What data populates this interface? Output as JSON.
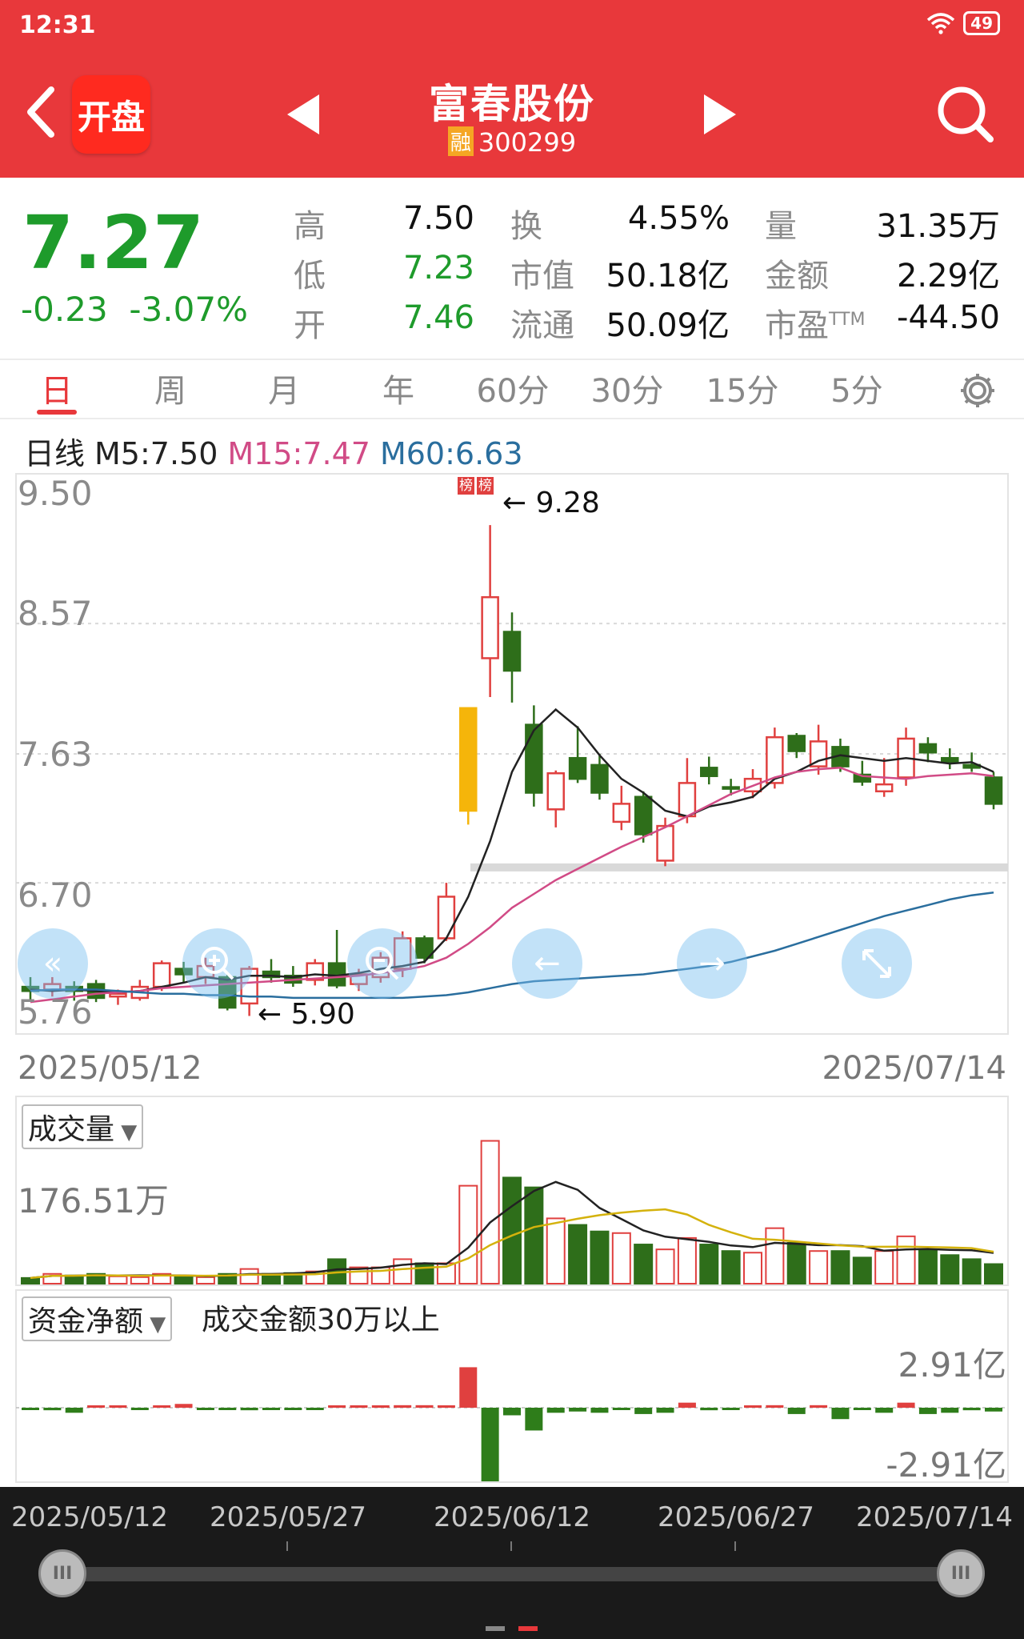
{
  "status": {
    "time": "12:31",
    "battery": "49"
  },
  "header": {
    "logo_text": "开盘",
    "name": "富春股份",
    "margin_badge": "融",
    "code": "300299"
  },
  "quote": {
    "price": "7.27",
    "change": "-0.23",
    "change_pct": "-3.07%",
    "stats": [
      {
        "label": "高",
        "value": "7.50"
      },
      {
        "label": "低",
        "value": "7.23"
      },
      {
        "label": "开",
        "value": "7.46"
      },
      {
        "label": "换",
        "value": "4.55%"
      },
      {
        "label": "市值",
        "value": "50.18亿"
      },
      {
        "label": "流通",
        "value": "50.09亿"
      },
      {
        "label": "量",
        "value": "31.35万"
      },
      {
        "label": "金额",
        "value": "2.29亿"
      },
      {
        "label": "市盈",
        "label_sup": "TTM",
        "value": "-44.50"
      }
    ]
  },
  "tabs": [
    "日",
    "周",
    "月",
    "年",
    "60分",
    "30分",
    "15分",
    "5分"
  ],
  "ma": {
    "title": "日线",
    "m5": "M5:7.50",
    "m15": "M15:7.47",
    "m60": "M60:6.63"
  },
  "price_axis": [
    "9.50",
    "8.57",
    "7.63",
    "6.70",
    "5.76"
  ],
  "annotations": {
    "high": "9.28",
    "low": "5.90",
    "bang": [
      "榜",
      "榜"
    ]
  },
  "range": {
    "start": "2025/05/12",
    "end": "2025/07/14"
  },
  "volume": {
    "label": "成交量",
    "max": "176.51万"
  },
  "fund": {
    "label": "资金净额",
    "desc": "成交金额30万以上",
    "max": "2.91亿",
    "min": "-2.91亿"
  },
  "scroller": {
    "dates": [
      "2025/05/12",
      "2025/05/27",
      "2025/06/12",
      "2025/06/27",
      "2025/07/14"
    ]
  },
  "colors": {
    "up": "#e0403f",
    "down": "#2e6e1a",
    "header": "#e8383b",
    "m5": "#222222",
    "m15": "#d14b86",
    "m60": "#2a6e9e"
  },
  "chart_data": {
    "type": "candlestick",
    "x_range": [
      "2025/05/12",
      "2025/07/14"
    ],
    "ylim": [
      5.76,
      9.5
    ],
    "candles": [
      {
        "o": 5.95,
        "c": 5.92,
        "h": 6.02,
        "l": 5.86
      },
      {
        "o": 5.93,
        "c": 5.97,
        "h": 6.02,
        "l": 5.88
      },
      {
        "o": 5.95,
        "c": 5.92,
        "h": 5.99,
        "l": 5.85
      },
      {
        "o": 5.97,
        "c": 5.87,
        "h": 6.0,
        "l": 5.84
      },
      {
        "o": 5.88,
        "c": 5.9,
        "h": 5.93,
        "l": 5.82
      },
      {
        "o": 5.87,
        "c": 5.95,
        "h": 6.0,
        "l": 5.85
      },
      {
        "o": 5.95,
        "c": 6.12,
        "h": 6.14,
        "l": 5.92
      },
      {
        "o": 6.08,
        "c": 6.04,
        "h": 6.13,
        "l": 5.98
      },
      {
        "o": 6.02,
        "c": 6.1,
        "h": 6.16,
        "l": 5.97
      },
      {
        "o": 6.02,
        "c": 5.8,
        "h": 6.04,
        "l": 5.78
      },
      {
        "o": 5.83,
        "c": 6.08,
        "h": 6.1,
        "l": 5.74
      },
      {
        "o": 6.06,
        "c": 6.02,
        "h": 6.15,
        "l": 5.98
      },
      {
        "o": 6.03,
        "c": 5.98,
        "h": 6.1,
        "l": 5.95
      },
      {
        "o": 6.0,
        "c": 6.12,
        "h": 6.15,
        "l": 5.96
      },
      {
        "o": 6.12,
        "c": 5.96,
        "h": 6.36,
        "l": 5.94
      },
      {
        "o": 5.97,
        "c": 6.04,
        "h": 6.08,
        "l": 5.92
      },
      {
        "o": 6.02,
        "c": 6.16,
        "h": 6.2,
        "l": 5.98
      },
      {
        "o": 6.08,
        "c": 6.3,
        "h": 6.35,
        "l": 6.02
      },
      {
        "o": 6.3,
        "c": 6.16,
        "h": 6.32,
        "l": 6.12
      },
      {
        "o": 6.3,
        "c": 6.6,
        "h": 6.7,
        "l": 6.28
      },
      {
        "o": 7.22,
        "c": 7.96,
        "h": 7.96,
        "l": 7.12,
        "limit_up": true
      },
      {
        "o": 8.32,
        "c": 8.76,
        "h": 9.28,
        "l": 8.04
      },
      {
        "o": 8.51,
        "c": 8.23,
        "h": 8.65,
        "l": 8.0
      },
      {
        "o": 7.84,
        "c": 7.35,
        "h": 7.98,
        "l": 7.25
      },
      {
        "o": 7.23,
        "c": 7.49,
        "h": 7.51,
        "l": 7.1
      },
      {
        "o": 7.6,
        "c": 7.45,
        "h": 7.83,
        "l": 7.42
      },
      {
        "o": 7.55,
        "c": 7.35,
        "h": 7.63,
        "l": 7.3
      },
      {
        "o": 7.14,
        "c": 7.27,
        "h": 7.4,
        "l": 7.08
      },
      {
        "o": 7.32,
        "c": 7.05,
        "h": 7.36,
        "l": 6.99
      },
      {
        "o": 6.86,
        "c": 7.11,
        "h": 7.17,
        "l": 6.82
      },
      {
        "o": 7.18,
        "c": 7.42,
        "h": 7.6,
        "l": 7.13
      },
      {
        "o": 7.53,
        "c": 7.47,
        "h": 7.61,
        "l": 7.41
      },
      {
        "o": 7.39,
        "c": 7.38,
        "h": 7.45,
        "l": 7.33
      },
      {
        "o": 7.36,
        "c": 7.45,
        "h": 7.52,
        "l": 7.31
      },
      {
        "o": 7.42,
        "c": 7.75,
        "h": 7.82,
        "l": 7.38
      },
      {
        "o": 7.76,
        "c": 7.65,
        "h": 7.78,
        "l": 7.6
      },
      {
        "o": 7.54,
        "c": 7.72,
        "h": 7.84,
        "l": 7.48
      },
      {
        "o": 7.68,
        "c": 7.54,
        "h": 7.74,
        "l": 7.5
      },
      {
        "o": 7.48,
        "c": 7.43,
        "h": 7.58,
        "l": 7.4
      },
      {
        "o": 7.36,
        "c": 7.41,
        "h": 7.6,
        "l": 7.32
      },
      {
        "o": 7.46,
        "c": 7.74,
        "h": 7.82,
        "l": 7.4
      },
      {
        "o": 7.7,
        "c": 7.64,
        "h": 7.75,
        "l": 7.57
      },
      {
        "o": 7.6,
        "c": 7.57,
        "h": 7.67,
        "l": 7.52
      },
      {
        "o": 7.55,
        "c": 7.53,
        "h": 7.64,
        "l": 7.5
      },
      {
        "o": 7.46,
        "c": 7.27,
        "h": 7.5,
        "l": 7.23
      }
    ],
    "ma_lines": [
      {
        "name": "M5",
        "values": [
          5.93,
          5.92,
          5.93,
          5.92,
          5.91,
          5.92,
          5.95,
          5.98,
          6.02,
          6.0,
          6.03,
          6.03,
          6.02,
          6.04,
          6.03,
          6.05,
          6.08,
          6.1,
          6.13,
          6.3,
          6.6,
          7.0,
          7.5,
          7.8,
          7.95,
          7.82,
          7.62,
          7.45,
          7.35,
          7.22,
          7.18,
          7.25,
          7.28,
          7.32,
          7.45,
          7.5,
          7.58,
          7.62,
          7.6,
          7.58,
          7.6,
          7.58,
          7.56,
          7.57,
          7.5
        ]
      },
      {
        "name": "M15",
        "values": [
          5.84,
          5.86,
          5.88,
          5.9,
          5.91,
          5.92,
          5.94,
          5.95,
          5.96,
          5.97,
          5.98,
          5.99,
          6.0,
          6.01,
          6.02,
          6.03,
          6.05,
          6.07,
          6.1,
          6.16,
          6.26,
          6.38,
          6.52,
          6.62,
          6.72,
          6.8,
          6.88,
          6.96,
          7.03,
          7.1,
          7.18,
          7.26,
          7.34,
          7.4,
          7.46,
          7.5,
          7.52,
          7.53,
          7.47,
          7.46,
          7.45,
          7.47,
          7.48,
          7.49,
          7.47
        ]
      },
      {
        "name": "M60",
        "values": [
          5.92,
          5.93,
          5.93,
          5.93,
          5.92,
          5.91,
          5.9,
          5.9,
          5.89,
          5.89,
          5.88,
          5.88,
          5.87,
          5.87,
          5.87,
          5.87,
          5.87,
          5.87,
          5.88,
          5.89,
          5.91,
          5.94,
          5.97,
          5.99,
          6.0,
          6.01,
          6.02,
          6.03,
          6.04,
          6.06,
          6.08,
          6.1,
          6.13,
          6.17,
          6.21,
          6.26,
          6.31,
          6.36,
          6.41,
          6.46,
          6.5,
          6.54,
          6.58,
          6.61,
          6.63
        ]
      }
    ],
    "volume_wan": [
      7,
      12,
      10,
      12,
      9,
      8,
      12,
      9,
      8,
      12,
      18,
      12,
      13,
      15,
      30,
      20,
      20,
      30,
      25,
      25,
      120,
      175,
      130,
      118,
      80,
      72,
      64,
      62,
      48,
      42,
      56,
      48,
      40,
      38,
      68,
      50,
      40,
      40,
      32,
      40,
      58,
      42,
      35,
      30,
      24
    ],
    "net_fund_yi": [
      -0.05,
      -0.1,
      -0.2,
      0.0,
      0.05,
      -0.02,
      0.02,
      0.15,
      -0.05,
      -0.02,
      -0.1,
      -0.08,
      -0.05,
      -0.03,
      0.0,
      0.05,
      0.0,
      0.1,
      0.1,
      0.05,
      1.6,
      -2.91,
      -0.3,
      -0.9,
      -0.2,
      -0.15,
      -0.2,
      -0.05,
      -0.25,
      -0.2,
      0.2,
      -0.1,
      -0.05,
      0.05,
      0.1,
      -0.25,
      0.1,
      -0.45,
      -0.05,
      -0.2,
      0.2,
      -0.25,
      -0.2,
      -0.1,
      -0.15
    ]
  }
}
